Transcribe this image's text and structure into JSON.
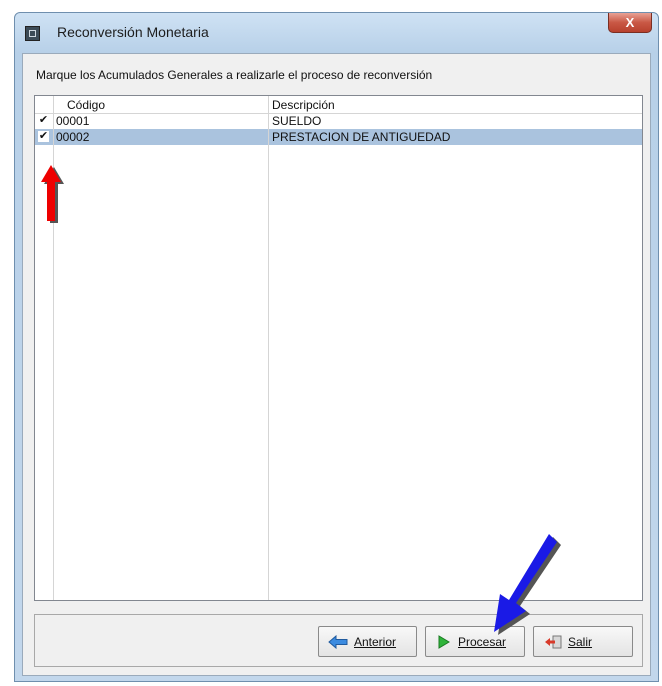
{
  "window": {
    "title": "Reconversión Monetaria",
    "close_label": "X"
  },
  "instruction": "Marque los Acumulados Generales  a realizarle el proceso de reconversión",
  "grid": {
    "columns": [
      "Código",
      "Descripción"
    ],
    "rows": [
      {
        "checked": true,
        "codigo": "00001",
        "descripcion": "SUELDO",
        "selected": false
      },
      {
        "checked": true,
        "codigo": "00002",
        "descripcion": "PRESTACION DE ANTIGUEDAD",
        "selected": true
      }
    ]
  },
  "buttons": {
    "anterior": {
      "label": "Anterior",
      "icon": "arrow-left-icon"
    },
    "procesar": {
      "label": "Procesar",
      "icon": "play-icon"
    },
    "salir": {
      "label": "Salir",
      "icon": "exit-icon"
    }
  },
  "annotations": {
    "red_arrow_color": "#ee0000",
    "blue_arrow_color": "#1a1ae6"
  }
}
